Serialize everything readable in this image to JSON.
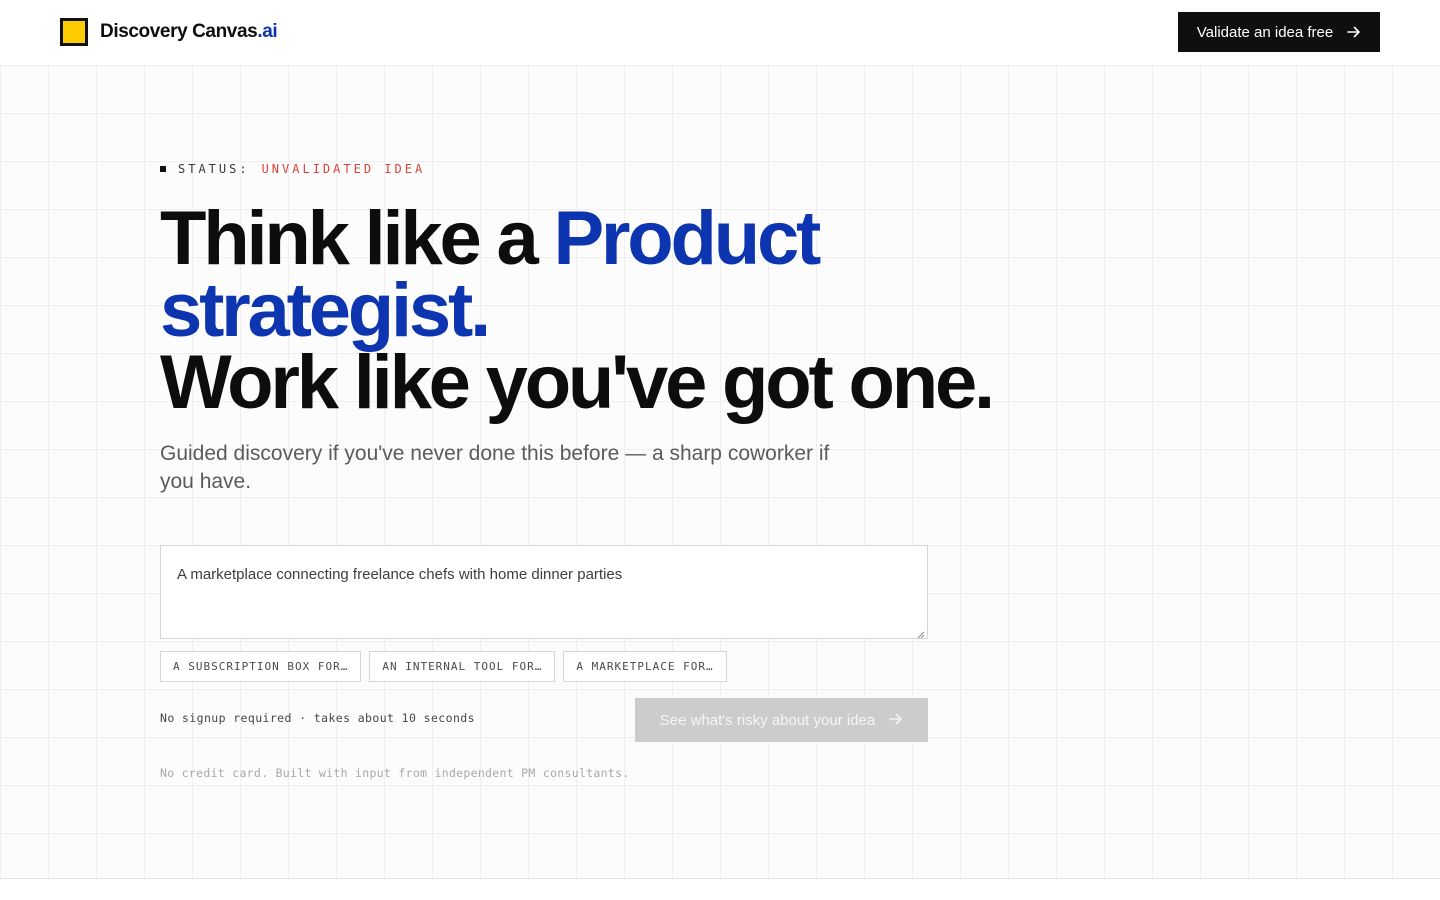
{
  "brand": {
    "name": "Discovery Canvas",
    "suffix": ".ai"
  },
  "nav": {
    "cta_label": "Validate an idea free",
    "cta_icon": "arrow-right-icon"
  },
  "status": {
    "label": "STATUS:",
    "value": "UNVALIDATED IDEA"
  },
  "headline": {
    "part1": "Think like a ",
    "accent1": "Product",
    "accent2": "strategist",
    "period1": ".",
    "line3": "Work like you've got one."
  },
  "subhead": "Guided discovery if you've never done this before — a sharp coworker if you have.",
  "idea_input": {
    "value": "A marketplace connecting freelance chefs with home dinner parties"
  },
  "chips": [
    {
      "label": "A SUBSCRIPTION BOX FOR…"
    },
    {
      "label": "AN INTERNAL TOOL FOR…"
    },
    {
      "label": "A MARKETPLACE FOR…"
    }
  ],
  "meta_note": "No signup required · takes about 10 seconds",
  "submit": {
    "label": "See what's risky about your idea",
    "icon": "arrow-right-icon"
  },
  "fine_print": "No credit card. Built with input from independent PM consultants.",
  "colors": {
    "accent_blue": "#0d35b0",
    "logo_yellow": "#ffcc00",
    "status_red": "#d8433a",
    "dark": "#0f0f0f",
    "disabled_button": "#cccccc"
  }
}
